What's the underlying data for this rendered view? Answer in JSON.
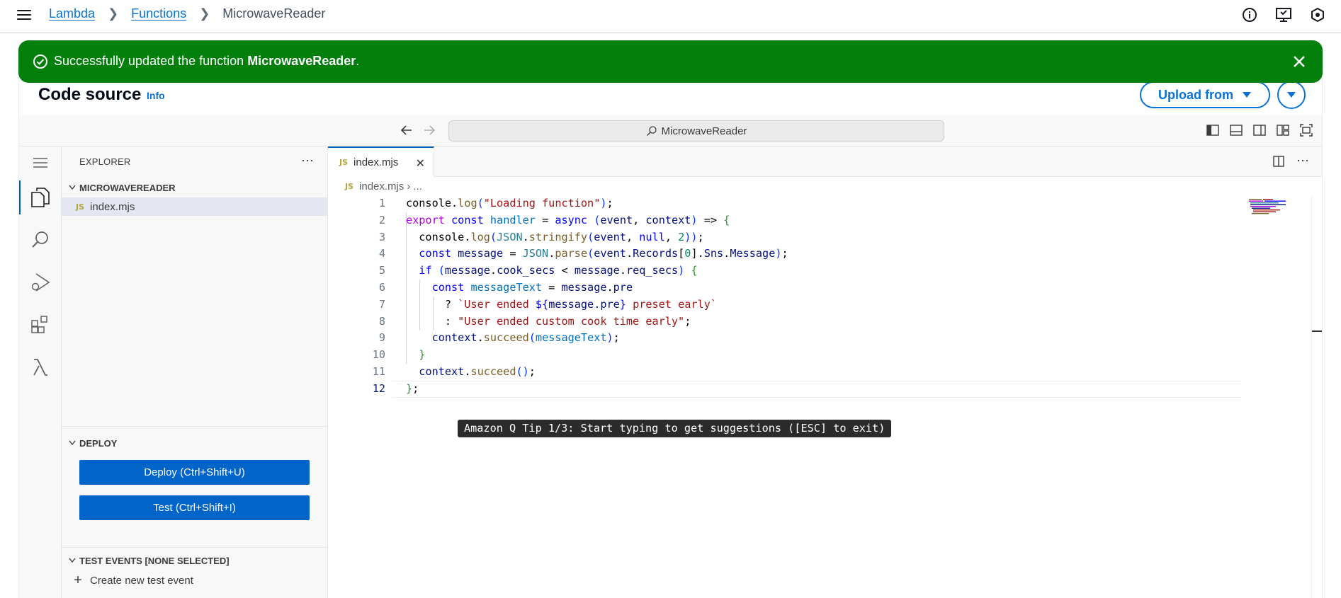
{
  "breadcrumbs": [
    {
      "label": "Lambda",
      "link": true
    },
    {
      "label": "Functions",
      "link": true
    },
    {
      "label": "MicrowaveReader",
      "link": false
    }
  ],
  "top_icons": [
    "info-icon",
    "feedback-icon",
    "settings-hex-icon"
  ],
  "flash": {
    "prefix": "Successfully updated the function ",
    "name": "MicrowaveReader",
    "suffix": ".",
    "color": "#037f0c"
  },
  "card": {
    "title": "Code source",
    "info": "Info",
    "upload_label": "Upload from"
  },
  "ide": {
    "command_center": "MicrowaveReader",
    "explorer_title": "EXPLORER",
    "folder": "MICROWAVEREADER",
    "file": "index.mjs",
    "file_badge": "JS",
    "deploy_section": "DEPLOY",
    "deploy_button": "Deploy (Ctrl+Shift+U)",
    "test_button": "Test (Ctrl+Shift+I)",
    "test_events_section": "TEST EVENTS [NONE SELECTED]",
    "create_test_event": "Create new test event",
    "tab_label": "index.mjs",
    "breadcrumb_file": "index.mjs",
    "breadcrumb_more": "...",
    "tip": "Amazon Q Tip 1/3: Start typing to get suggestions ([ESC] to exit)",
    "accent": "#005fb8"
  },
  "code_lines": [
    "console.log(\"Loading function\");",
    "export const handler = async (event, context) => {",
    "  console.log(JSON.stringify(event, null, 2));",
    "  const message = JSON.parse(event.Records[0].Sns.Message);",
    "  if (message.cook_secs < message.req_secs) {",
    "    const messageText = message.pre",
    "      ? `User ended ${message.pre} preset early`",
    "      : \"User ended custom cook time early\";",
    "    context.succeed(messageText);",
    "  }",
    "  context.succeed();",
    "};"
  ],
  "current_line": 12
}
